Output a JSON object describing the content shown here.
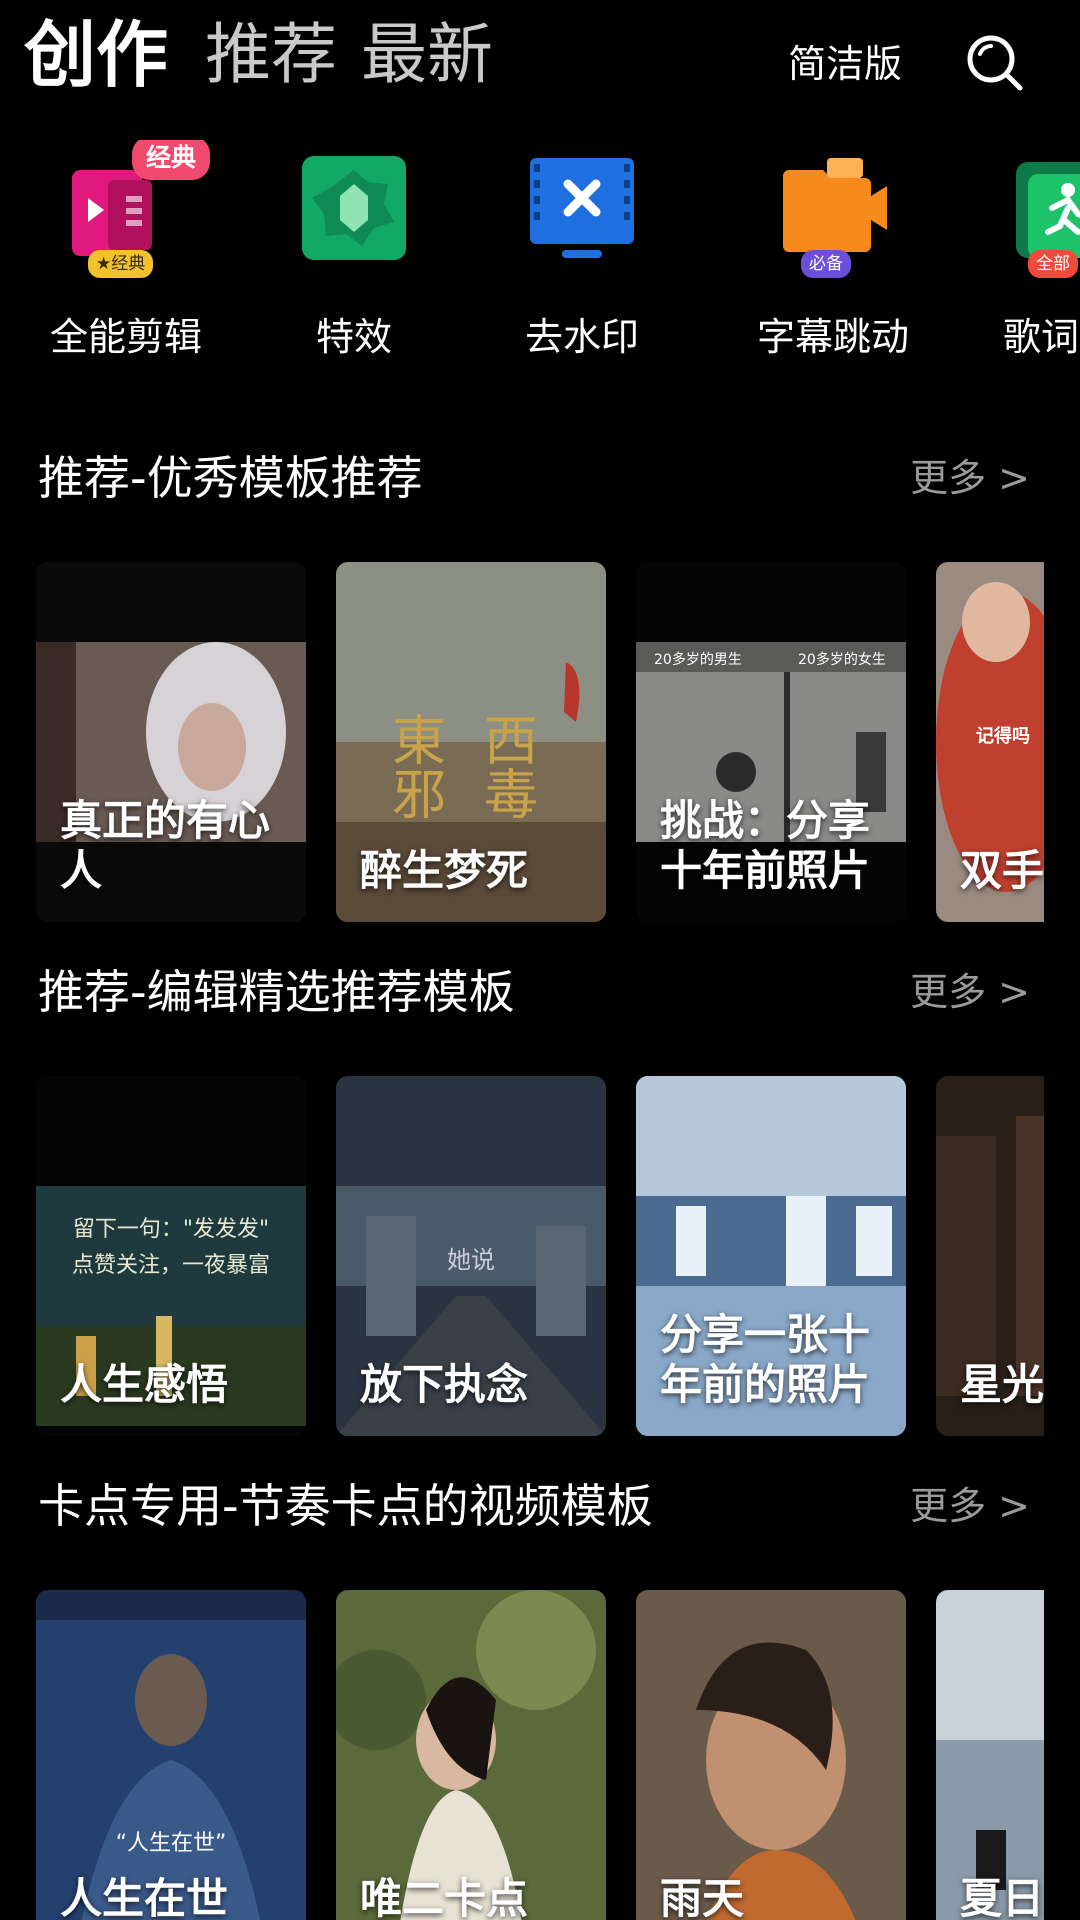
{
  "header": {
    "tabs": [
      {
        "label": "创作",
        "active": true
      },
      {
        "label": "推荐",
        "active": false
      },
      {
        "label": "最新",
        "active": false
      }
    ],
    "simple_mode_label": "简洁版",
    "search_icon": "search-icon"
  },
  "tools": [
    {
      "label": "全能剪辑",
      "icon": "video-edit-icon",
      "badge": "经典",
      "mini_badge": "★经典"
    },
    {
      "label": "特效",
      "icon": "effects-icon"
    },
    {
      "label": "去水印",
      "icon": "remove-watermark-icon"
    },
    {
      "label": "字幕跳动",
      "icon": "subtitle-bounce-icon",
      "mini_badge": "必备"
    },
    {
      "label": "歌词跳",
      "icon": "lyrics-bounce-icon",
      "mini_badge": "全部"
    }
  ],
  "sections": [
    {
      "title": "推荐-优秀模板推荐",
      "more": "更多 >",
      "cards": [
        {
          "title": "真正的有心人",
          "colors": [
            "#6a5a54",
            "#d7d2d6",
            "#1a1a1a"
          ]
        },
        {
          "title": "醉生梦死",
          "colors": [
            "#8c8f84",
            "#7a6b55",
            "#4a3a2a"
          ],
          "overlay_text": [
            "東邪",
            "西毒"
          ]
        },
        {
          "title": "挑战：分享十年前照片",
          "colors": [
            "#3a3a3a",
            "#8a8a88",
            "#2a2a2a"
          ],
          "overlay_text": [
            "20多岁的男生",
            "20多岁的女生"
          ]
        },
        {
          "title": "双手",
          "colors": [
            "#9a6a5a",
            "#c04030",
            "#6a5a50"
          ],
          "overlay_text": [
            "记得吗"
          ]
        }
      ]
    },
    {
      "title": "推荐-编辑精选推荐模板",
      "more": "更多 >",
      "cards": [
        {
          "title": "人生感悟",
          "colors": [
            "#1a2a30",
            "#25392e",
            "#2a3a40"
          ],
          "overlay_text": [
            "留下一句：\"发发发\"",
            "点赞关注，一夜暴富"
          ]
        },
        {
          "title": "放下执念",
          "colors": [
            "#3c4a58",
            "#5e6e7a",
            "#2a3440"
          ],
          "overlay_text": [
            "她说"
          ]
        },
        {
          "title": "分享一张十年前的照片",
          "colors": [
            "#4a6a90",
            "#b6c8dc",
            "#5a7aa0"
          ]
        },
        {
          "title": "星光",
          "colors": [
            "#3a2a22",
            "#1a1410",
            "#2a1e18"
          ]
        }
      ]
    },
    {
      "title": "卡点专用-节奏卡点的视频模板",
      "more": "更多 >",
      "cards": [
        {
          "title": "人生在世",
          "colors": [
            "#23406e",
            "#3a5a8a",
            "#1a2a4a"
          ],
          "overlay_text": [
            "“人生在世”"
          ]
        },
        {
          "title": "唯二卡点",
          "colors": [
            "#5a6a3a",
            "#c8c0a8",
            "#4a5a30"
          ]
        },
        {
          "title": "雨天",
          "colors": [
            "#6a5a4a",
            "#c09070",
            "#3a3430"
          ]
        },
        {
          "title": "夏日",
          "colors": [
            "#8a9aa8",
            "#c8d0d8",
            "#4a5a6a"
          ]
        }
      ]
    }
  ]
}
